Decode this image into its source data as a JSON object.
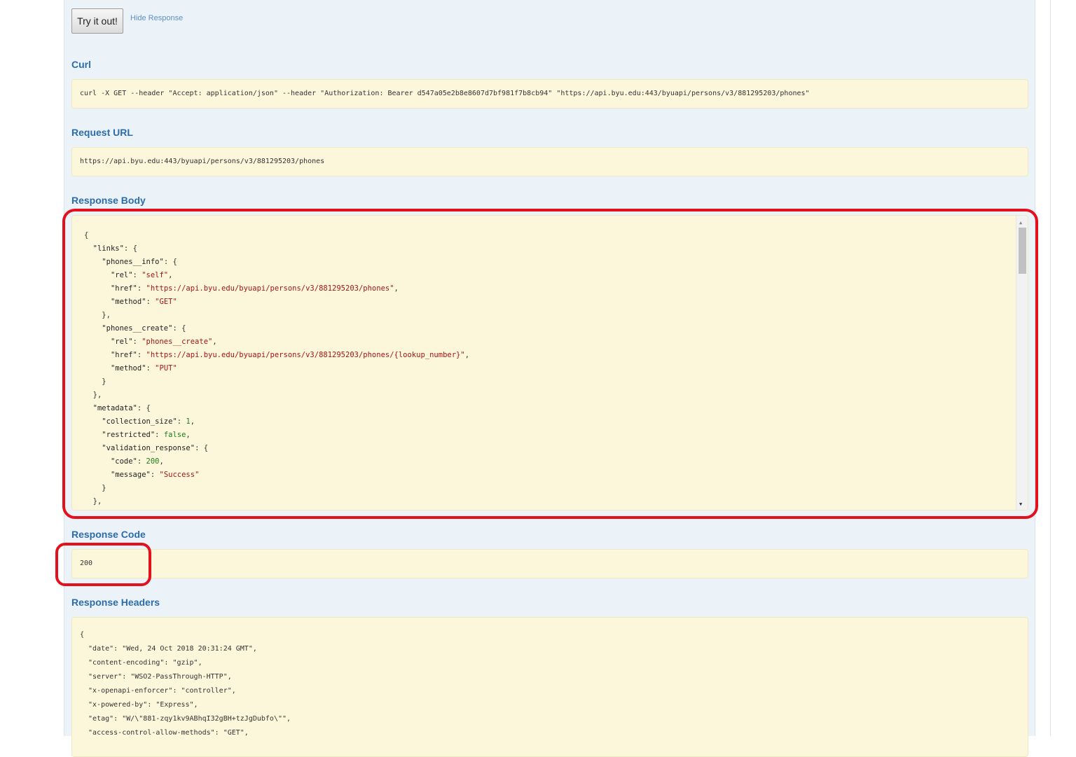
{
  "actions": {
    "try_button": "Try it out!",
    "hide_link": "Hide Response"
  },
  "sections": {
    "curl_title": "Curl",
    "request_url_title": "Request URL",
    "response_body_title": "Response Body",
    "response_code_title": "Response Code",
    "response_headers_title": "Response Headers"
  },
  "curl": "curl -X GET --header \"Accept: application/json\" --header \"Authorization: Bearer d547a05e2b8e8607d7bf981f7b8cb94\" \"https://api.byu.edu:443/byuapi/persons/v3/881295203/phones\"",
  "request_url": "https://api.byu.edu:443/byuapi/persons/v3/881295203/phones",
  "response_body": [
    [
      {
        "t": "p",
        "v": "{"
      }
    ],
    [
      {
        "t": "p",
        "v": "  "
      },
      {
        "t": "k",
        "v": "\"links\""
      },
      {
        "t": "p",
        "v": ": {"
      }
    ],
    [
      {
        "t": "p",
        "v": "    "
      },
      {
        "t": "k",
        "v": "\"phones__info\""
      },
      {
        "t": "p",
        "v": ": {"
      }
    ],
    [
      {
        "t": "p",
        "v": "      "
      },
      {
        "t": "k",
        "v": "\"rel\""
      },
      {
        "t": "p",
        "v": ": "
      },
      {
        "t": "s",
        "v": "\"self\""
      },
      {
        "t": "p",
        "v": ","
      }
    ],
    [
      {
        "t": "p",
        "v": "      "
      },
      {
        "t": "k",
        "v": "\"href\""
      },
      {
        "t": "p",
        "v": ": "
      },
      {
        "t": "s",
        "v": "\"https://api.byu.edu/byuapi/persons/v3/881295203/phones\""
      },
      {
        "t": "p",
        "v": ","
      }
    ],
    [
      {
        "t": "p",
        "v": "      "
      },
      {
        "t": "k",
        "v": "\"method\""
      },
      {
        "t": "p",
        "v": ": "
      },
      {
        "t": "s",
        "v": "\"GET\""
      }
    ],
    [
      {
        "t": "p",
        "v": "    },"
      }
    ],
    [
      {
        "t": "p",
        "v": "    "
      },
      {
        "t": "k",
        "v": "\"phones__create\""
      },
      {
        "t": "p",
        "v": ": {"
      }
    ],
    [
      {
        "t": "p",
        "v": "      "
      },
      {
        "t": "k",
        "v": "\"rel\""
      },
      {
        "t": "p",
        "v": ": "
      },
      {
        "t": "s",
        "v": "\"phones__create\""
      },
      {
        "t": "p",
        "v": ","
      }
    ],
    [
      {
        "t": "p",
        "v": "      "
      },
      {
        "t": "k",
        "v": "\"href\""
      },
      {
        "t": "p",
        "v": ": "
      },
      {
        "t": "s",
        "v": "\"https://api.byu.edu/byuapi/persons/v3/881295203/phones/{lookup_number}\""
      },
      {
        "t": "p",
        "v": ","
      }
    ],
    [
      {
        "t": "p",
        "v": "      "
      },
      {
        "t": "k",
        "v": "\"method\""
      },
      {
        "t": "p",
        "v": ": "
      },
      {
        "t": "s",
        "v": "\"PUT\""
      }
    ],
    [
      {
        "t": "p",
        "v": "    }"
      }
    ],
    [
      {
        "t": "p",
        "v": "  },"
      }
    ],
    [
      {
        "t": "p",
        "v": "  "
      },
      {
        "t": "k",
        "v": "\"metadata\""
      },
      {
        "t": "p",
        "v": ": {"
      }
    ],
    [
      {
        "t": "p",
        "v": "    "
      },
      {
        "t": "k",
        "v": "\"collection_size\""
      },
      {
        "t": "p",
        "v": ": "
      },
      {
        "t": "n",
        "v": "1"
      },
      {
        "t": "p",
        "v": ","
      }
    ],
    [
      {
        "t": "p",
        "v": "    "
      },
      {
        "t": "k",
        "v": "\"restricted\""
      },
      {
        "t": "p",
        "v": ": "
      },
      {
        "t": "b",
        "v": "false"
      },
      {
        "t": "p",
        "v": ","
      }
    ],
    [
      {
        "t": "p",
        "v": "    "
      },
      {
        "t": "k",
        "v": "\"validation_response\""
      },
      {
        "t": "p",
        "v": ": {"
      }
    ],
    [
      {
        "t": "p",
        "v": "      "
      },
      {
        "t": "k",
        "v": "\"code\""
      },
      {
        "t": "p",
        "v": ": "
      },
      {
        "t": "n",
        "v": "200"
      },
      {
        "t": "p",
        "v": ","
      }
    ],
    [
      {
        "t": "p",
        "v": "      "
      },
      {
        "t": "k",
        "v": "\"message\""
      },
      {
        "t": "p",
        "v": ": "
      },
      {
        "t": "s",
        "v": "\"Success\""
      }
    ],
    [
      {
        "t": "p",
        "v": "    }"
      }
    ],
    [
      {
        "t": "p",
        "v": "  },"
      }
    ]
  ],
  "response_code": "200",
  "response_headers": [
    "{",
    "  \"date\": \"Wed, 24 Oct 2018 20:31:24 GMT\",",
    "  \"content-encoding\": \"gzip\",",
    "  \"server\": \"WSO2-PassThrough-HTTP\",",
    "  \"x-openapi-enforcer\": \"controller\",",
    "  \"x-powered-by\": \"Express\",",
    "  \"etag\": \"W/\\\"881-zqy1kv9ABhqI32gBH+tzJgDubfo\\\"\",",
    "  \"access-control-allow-methods\": \"GET\","
  ],
  "icons": {
    "scroll_up": "▲",
    "scroll_down": "▼"
  },
  "colors": {
    "highlight": "#e3101e",
    "heading": "#2c6ca8",
    "box_bg": "#fcf6db"
  }
}
